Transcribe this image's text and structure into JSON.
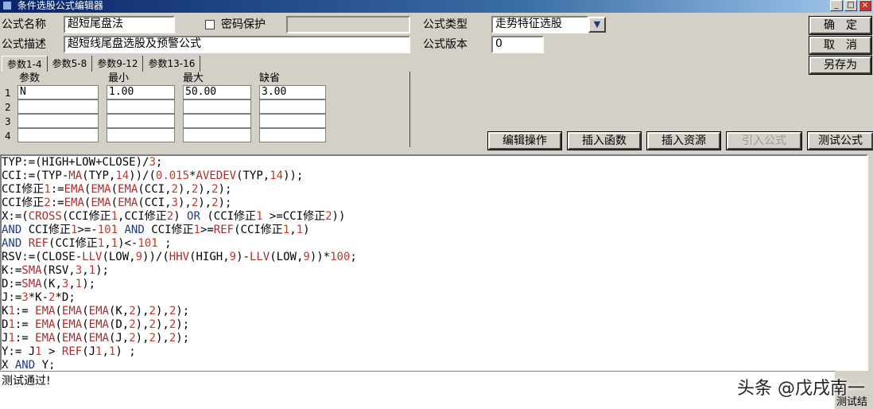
{
  "window": {
    "title": "条件选股公式编辑器",
    "controls": [
      "_",
      "□",
      "×"
    ]
  },
  "form": {
    "name_label": "公式名称",
    "name_value": "超短尾盘法",
    "password_label": "密码保护",
    "desc_label": "公式描述",
    "desc_value": "超短线尾盘选股及预警公式",
    "type_label": "公式类型",
    "type_value": "走势特征选股",
    "version_label": "公式版本",
    "version_value": "0"
  },
  "buttons": {
    "ok": "确　定",
    "cancel": "取　消",
    "save_as": "另存为",
    "edit_op": "编辑操作",
    "insert_func": "插入函数",
    "insert_res": "插入资源",
    "import_formula": "引入公式",
    "test_formula": "测试公式"
  },
  "tabs": [
    "参数1-4",
    "参数5-8",
    "参数9-12",
    "参数13-16"
  ],
  "params": {
    "headers": [
      "参数",
      "最小",
      "最大",
      "缺省"
    ],
    "rows": [
      {
        "num": "1",
        "name": "N",
        "min": "1.00",
        "max": "50.00",
        "def": "3.00"
      },
      {
        "num": "2",
        "name": "",
        "min": "",
        "max": "",
        "def": ""
      },
      {
        "num": "3",
        "name": "",
        "min": "",
        "max": "",
        "def": ""
      },
      {
        "num": "4",
        "name": "",
        "min": "",
        "max": "",
        "def": ""
      }
    ]
  },
  "code": [
    "TYP:=(HIGH+LOW+CLOSE)/3;",
    "CCI:=(TYP-MA(TYP,14))/(0.015*AVEDEV(TYP,14));",
    "CCI修正1:=EMA(EMA(EMA(CCI,2),2),2);",
    "CCI修正2:=EMA(EMA(EMA(CCI,3),2),2);",
    "X:=(CROSS(CCI修正1,CCI修正2) OR (CCI修正1 >=CCI修正2))",
    "AND CCI修正1>=-101 AND CCI修正1>=REF(CCI修正1,1)",
    "AND REF(CCI修正1,1)<-101 ;",
    "RSV:=(CLOSE-LLV(LOW,9))/(HHV(HIGH,9)-LLV(LOW,9))*100;",
    "K:=SMA(RSV,3,1);",
    "D:=SMA(K,3,1);",
    "J:=3*K-2*D;",
    "K1:= EMA(EMA(EMA(K,2),2),2);",
    "D1:= EMA(EMA(EMA(D,2),2),2);",
    "J1:= EMA(EMA(EMA(J,2),2),2);",
    "Y:= J1 > REF(J1,1) ;",
    "X AND Y;"
  ],
  "status": {
    "text": "测试通过!",
    "right_fragment": "测试结"
  },
  "watermark": "头条 @戊戌南一",
  "colors": {
    "function": "#b02a2a",
    "number": "#c0392b",
    "keyword": "#1a3a8a"
  }
}
